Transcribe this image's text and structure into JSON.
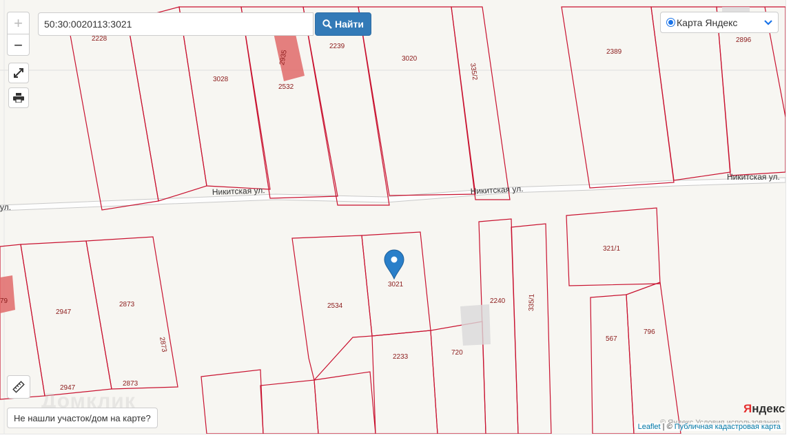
{
  "search": {
    "value": "50:30:0020113:3021",
    "button_label": "Найти"
  },
  "zoom": {
    "in_label": "+",
    "out_label": "−"
  },
  "layer_select": {
    "selected": "Карта Яндекс"
  },
  "not_found_label": "Не нашли участок/дом на карте?",
  "watermark": "Домклик",
  "yandex_logo": {
    "first": "Я",
    "rest": "ндекс"
  },
  "yandex_terms": "© Яндекс Условия использования",
  "attribution": {
    "leaflet": "Leaflet",
    "separator": " | © ",
    "pkk": "Публичная кадастровая карта"
  },
  "streets": {
    "left": "ул.",
    "mid_left": "Никитская ул.",
    "mid": "Никитская ул.",
    "right": "Никитская ул."
  },
  "parcels": {
    "p2228": "2228",
    "p2935": "2935",
    "p2239": "2239",
    "p3020": "3020",
    "p335_2": "335/2",
    "p2389": "2389",
    "p2896": "2896",
    "p3028": "3028",
    "p2532": "2532",
    "p321_1": "321/1",
    "p3021": "3021",
    "p2534": "2534",
    "p2240": "2240",
    "p335_1": "335/1",
    "p2947a": "2947",
    "p2873a": "2873",
    "p2873b": "2873",
    "p2873c": "2873",
    "p2947b": "2947",
    "p567": "567",
    "p796": "796",
    "p2233": "2233",
    "p720": "720",
    "p79": "79"
  },
  "colors": {
    "parcel_line": "#c8102e",
    "parcel_fill": "#e06a6a",
    "button": "#337ab7",
    "pin": "#2a7fc9"
  },
  "icons": [
    "search-icon",
    "fullscreen-icon",
    "print-icon",
    "ruler-icon",
    "chevron-down-icon",
    "map-pin-icon"
  ]
}
